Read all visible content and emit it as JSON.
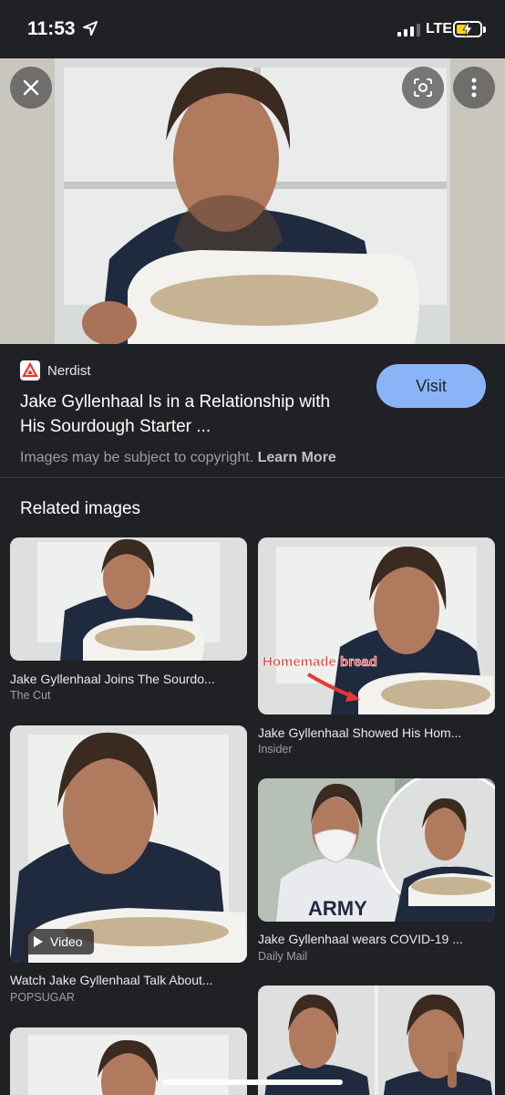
{
  "status": {
    "time": "11:53",
    "network": "LTE"
  },
  "viewer": {
    "source": "Nerdist",
    "title_line1": "Jake Gyllenhaal Is in a Relationship with",
    "title_line2": "His Sourdough Starter ...",
    "visit_label": "Visit",
    "copyright_text": "Images may be subject to copyright.",
    "learn_more_label": "Learn More",
    "overlay_text": "Homemade bread"
  },
  "related": {
    "heading": "Related images",
    "items": [
      {
        "caption": "Jake Gyllenhaal Joins The Sourdo...",
        "source": "The Cut"
      },
      {
        "caption": "Jake Gyllenhaal Showed His Hom...",
        "source": "Insider"
      },
      {
        "caption": "Watch Jake Gyllenhaal Talk About...",
        "source": "POPSUGAR",
        "badge": "Video"
      },
      {
        "caption": "Jake Gyllenhaal wears COVID-19 ...",
        "source": "Daily Mail"
      }
    ]
  },
  "colors": {
    "background": "#202124",
    "accent": "#8ab4f8",
    "battery": "#ffd60a"
  }
}
